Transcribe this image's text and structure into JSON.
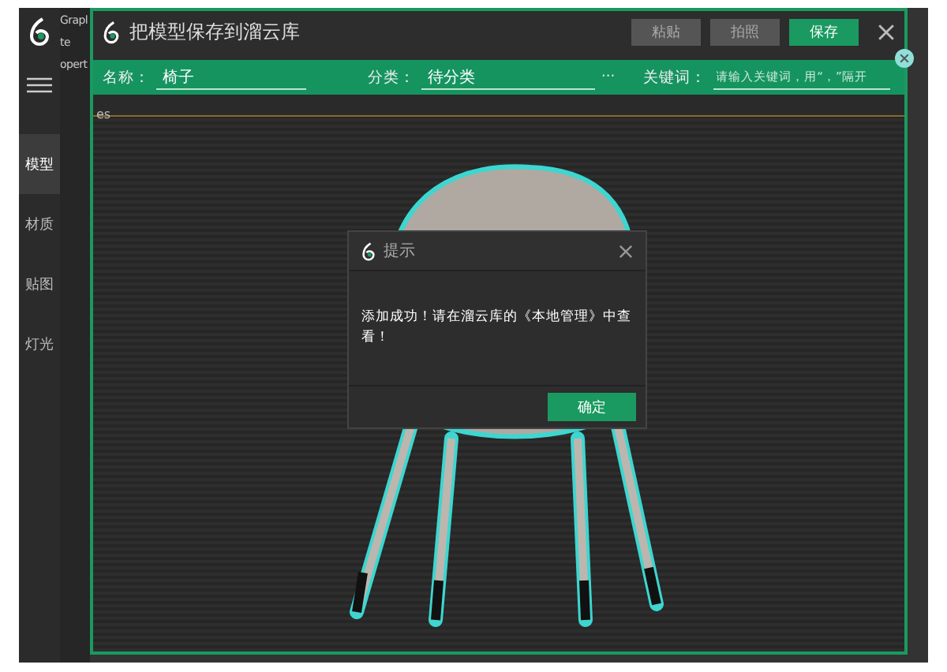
{
  "app": {
    "sidebar": {
      "items": [
        {
          "label": "模型",
          "selected": true
        },
        {
          "label": "材质",
          "selected": false
        },
        {
          "label": "贴图",
          "selected": false
        },
        {
          "label": "灯光",
          "selected": false
        }
      ]
    },
    "fragments": [
      "Grapl",
      "te",
      "opert"
    ]
  },
  "save_dialog": {
    "title": "把模型保存到溜云库",
    "buttons": [
      {
        "label": "粘贴",
        "kind": "secondary"
      },
      {
        "label": "拍照",
        "kind": "secondary"
      },
      {
        "label": "保存",
        "kind": "primary"
      }
    ],
    "form": {
      "name_label": "名称：",
      "name_value": "椅子",
      "category_label": "分类：",
      "category_value": "待分类",
      "category_more": "···",
      "keywords_label": "关键词：",
      "keywords_placeholder": "请输入关键词，用“，”隔开"
    },
    "viewport_label": "es"
  },
  "alert": {
    "title": "提示",
    "message": "添加成功！请在溜云库的《本地管理》中查看！",
    "confirm": "确定"
  }
}
